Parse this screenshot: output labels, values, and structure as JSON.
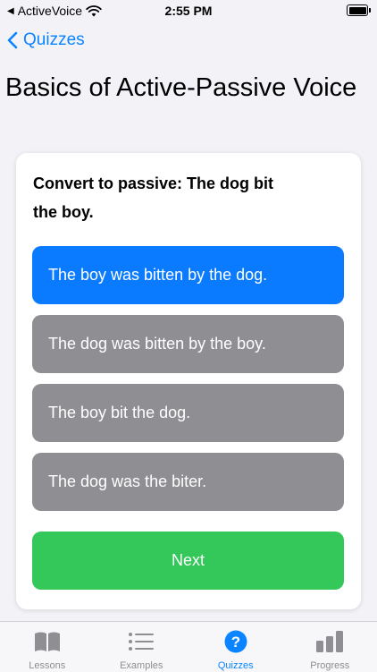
{
  "status_bar": {
    "app_name": "ActiveVoice",
    "time": "2:55 PM"
  },
  "nav": {
    "back_label": "Quizzes"
  },
  "page": {
    "title": "Basics of Active-Passive Voice"
  },
  "quiz": {
    "question": "Convert to passive: The dog bit the boy.",
    "options": [
      {
        "label": "The boy was bitten by the dog.",
        "selected": true
      },
      {
        "label": "The dog was bitten by the boy.",
        "selected": false
      },
      {
        "label": "The boy bit the dog.",
        "selected": false
      },
      {
        "label": "The dog was the biter.",
        "selected": false
      }
    ],
    "next_label": "Next"
  },
  "tab_bar": {
    "tabs": [
      {
        "label": "Lessons",
        "icon": "book-icon",
        "active": false
      },
      {
        "label": "Examples",
        "icon": "list-icon",
        "active": false
      },
      {
        "label": "Quizzes",
        "icon": "question-circle-icon",
        "active": true
      },
      {
        "label": "Progress",
        "icon": "bar-chart-icon",
        "active": false
      }
    ]
  },
  "colors": {
    "accent": "#0a84ff",
    "selected_option": "#0a7bff",
    "unselected_option": "#8e8e93",
    "next_button": "#34c759"
  }
}
